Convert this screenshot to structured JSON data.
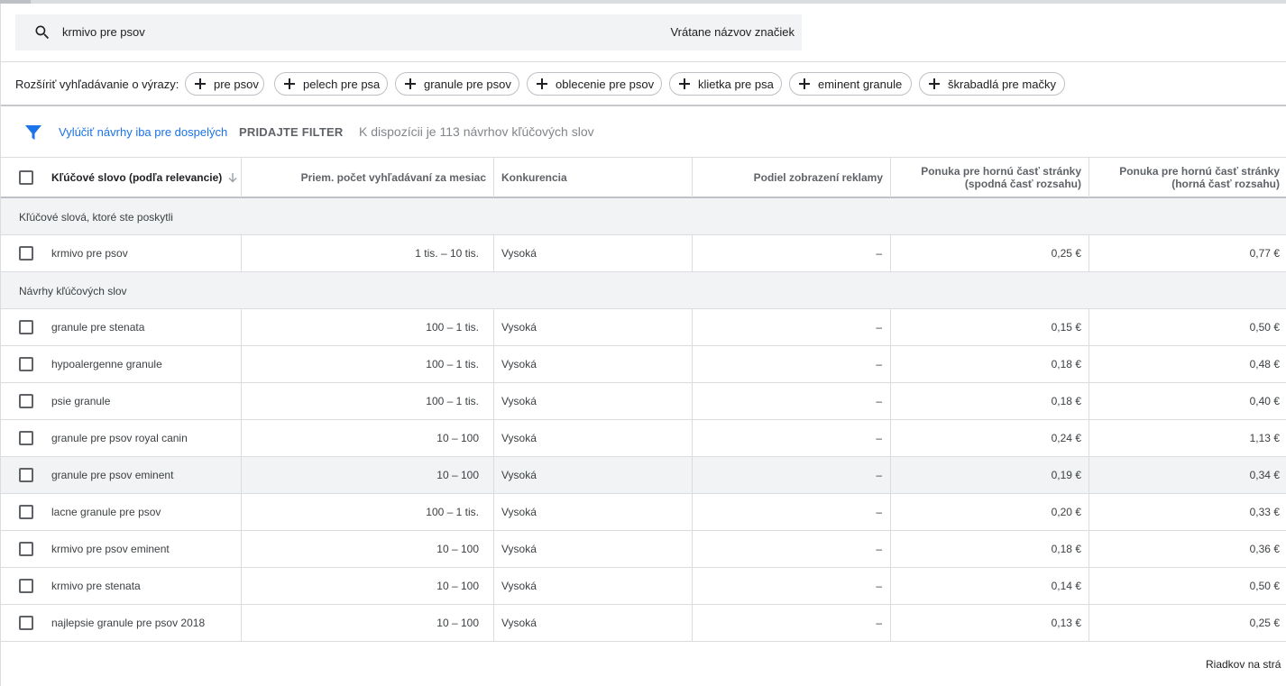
{
  "search": {
    "query": "krmivo pre psov",
    "brand_option": "Vrátane názvov značiek"
  },
  "expand": {
    "label": "Rozšíriť vyhľadávanie o výrazy:",
    "chips": [
      "pre psov",
      "pelech pre psa",
      "granule pre psov",
      "oblecenie pre psov",
      "klietka pre psa",
      "eminent granule",
      "škrabadlá pre mačky"
    ]
  },
  "filter_bar": {
    "adult_link": "Vylúčiť návrhy iba pre dospelých",
    "add_filter": "PRIDAJTE FILTER",
    "available": "K dispozícii je 113 návrhov kľúčových slov"
  },
  "table": {
    "columns": {
      "keyword": "Kľúčové slovo (podľa relevancie)",
      "searches": "Priem. počet vyhľadávaní za mesiac",
      "competition": "Konkurencia",
      "impression_share": "Podiel zobrazení reklamy",
      "bid_low": "Ponuka pre hornú časť stránky (spodná časť rozsahu)",
      "bid_high": "Ponuka pre hornú časť stránky (horná časť rozsahu)"
    },
    "group_provided": "Kľúčové slová, ktoré ste poskytli",
    "provided_rows": [
      {
        "keyword": "krmivo pre psov",
        "searches": "1 tis. – 10 tis.",
        "competition": "Vysoká",
        "impression_share": "–",
        "bid_low": "0,25 €",
        "bid_high": "0,77 €"
      }
    ],
    "group_suggestions": "Návrhy kľúčových slov",
    "suggestion_rows": [
      {
        "keyword": "granule pre stenata",
        "searches": "100 – 1 tis.",
        "competition": "Vysoká",
        "impression_share": "–",
        "bid_low": "0,15 €",
        "bid_high": "0,50 €"
      },
      {
        "keyword": "hypoalergenne granule",
        "searches": "100 – 1 tis.",
        "competition": "Vysoká",
        "impression_share": "–",
        "bid_low": "0,18 €",
        "bid_high": "0,48 €"
      },
      {
        "keyword": "psie granule",
        "searches": "100 – 1 tis.",
        "competition": "Vysoká",
        "impression_share": "–",
        "bid_low": "0,18 €",
        "bid_high": "0,40 €"
      },
      {
        "keyword": "granule pre psov royal canin",
        "searches": "10 – 100",
        "competition": "Vysoká",
        "impression_share": "–",
        "bid_low": "0,24 €",
        "bid_high": "1,13 €"
      },
      {
        "keyword": "granule pre psov eminent",
        "searches": "10 – 100",
        "competition": "Vysoká",
        "impression_share": "–",
        "bid_low": "0,19 €",
        "bid_high": "0,34 €"
      },
      {
        "keyword": "lacne granule pre psov",
        "searches": "100 – 1 tis.",
        "competition": "Vysoká",
        "impression_share": "–",
        "bid_low": "0,20 €",
        "bid_high": "0,33 €"
      },
      {
        "keyword": "krmivo pre psov eminent",
        "searches": "10 – 100",
        "competition": "Vysoká",
        "impression_share": "–",
        "bid_low": "0,18 €",
        "bid_high": "0,36 €"
      },
      {
        "keyword": "krmivo pre stenata",
        "searches": "10 – 100",
        "competition": "Vysoká",
        "impression_share": "–",
        "bid_low": "0,14 €",
        "bid_high": "0,50 €"
      },
      {
        "keyword": "najlepsie granule pre psov 2018",
        "searches": "10 – 100",
        "competition": "Vysoká",
        "impression_share": "–",
        "bid_low": "0,13 €",
        "bid_high": "0,25 €"
      }
    ]
  },
  "footer": {
    "rows_per_page": "Riadkov na strá"
  }
}
